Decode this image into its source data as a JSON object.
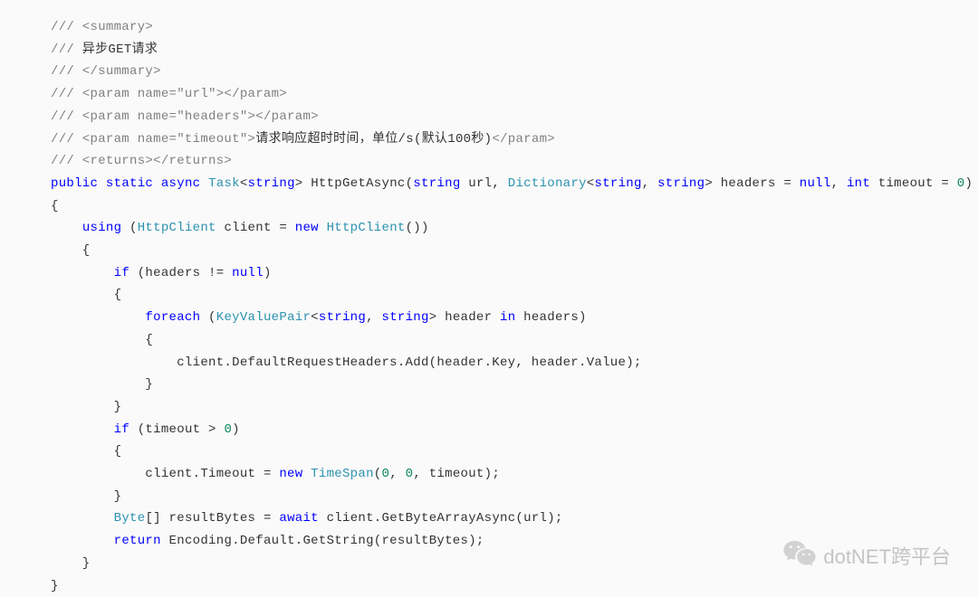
{
  "code": {
    "l1": "/// <summary>",
    "l2_head": "///",
    "l2_tail": " 异步GET请求",
    "l3": "/// </summary>",
    "l4": "/// <param name=\"url\"></param>",
    "l5": "/// <param name=\"headers\"></param>",
    "l6_a": "/// <param name=\"timeout\">",
    "l6_b": "请求响应超时时间，单位/s(默认100秒)",
    "l6_c": "</param>",
    "l7": "/// <returns></returns>",
    "l8": {
      "kw_public": "public",
      "kw_static": "static",
      "kw_async": "async",
      "type_task": "Task",
      "type_string1": "string",
      "name": " HttpGetAsync(",
      "type_string2": "string",
      "p1": " url, ",
      "type_dict": "Dictionary",
      "type_string3": "string",
      "comma": ", ",
      "type_string4": "string",
      "p2": "> headers = ",
      "kw_null": "null",
      "p3": ", ",
      "kw_int": "int",
      "p4": " timeout = ",
      "num0": "0",
      "p5": ")"
    },
    "l9": "{",
    "l10": {
      "indent": "    ",
      "kw_using": "using",
      "p1": " (",
      "type_hc1": "HttpClient",
      "p2": " client = ",
      "kw_new": "new",
      "p3": " ",
      "type_hc2": "HttpClient",
      "p4": "())"
    },
    "l11": "    {",
    "l12": {
      "indent": "        ",
      "kw_if": "if",
      "p1": " (headers != ",
      "kw_null": "null",
      "p2": ")"
    },
    "l13": "        {",
    "l14": {
      "indent": "            ",
      "kw_foreach": "foreach",
      "p1": " (",
      "type_kvp": "KeyValuePair",
      "lt": "<",
      "type_s1": "string",
      "c": ", ",
      "type_s2": "string",
      "p2": "> header ",
      "kw_in": "in",
      "p3": " headers)"
    },
    "l15": "            {",
    "l16": "                client.DefaultRequestHeaders.Add(header.Key, header.Value);",
    "l17": "            }",
    "l18": "        }",
    "l19": {
      "indent": "        ",
      "kw_if": "if",
      "p1": " (timeout > ",
      "num0": "0",
      "p2": ")"
    },
    "l20": "        {",
    "l21": {
      "indent": "            ",
      "p1": "client.Timeout = ",
      "kw_new": "new",
      "p2": " ",
      "type_ts": "TimeSpan",
      "p3": "(",
      "n1": "0",
      "c1": ", ",
      "n2": "0",
      "c2": ", timeout);"
    },
    "l22": "        }",
    "l23": {
      "indent": "        ",
      "type_byte": "Byte",
      "p1": "[] resultBytes = ",
      "kw_await": "await",
      "p2": " client.GetByteArrayAsync(url);"
    },
    "l24": {
      "indent": "        ",
      "kw_return": "return",
      "p1": " Encoding.Default.GetString(resultBytes);"
    },
    "l25": "    }",
    "l26": "}"
  },
  "watermark": {
    "text": "dotNET跨平台"
  }
}
